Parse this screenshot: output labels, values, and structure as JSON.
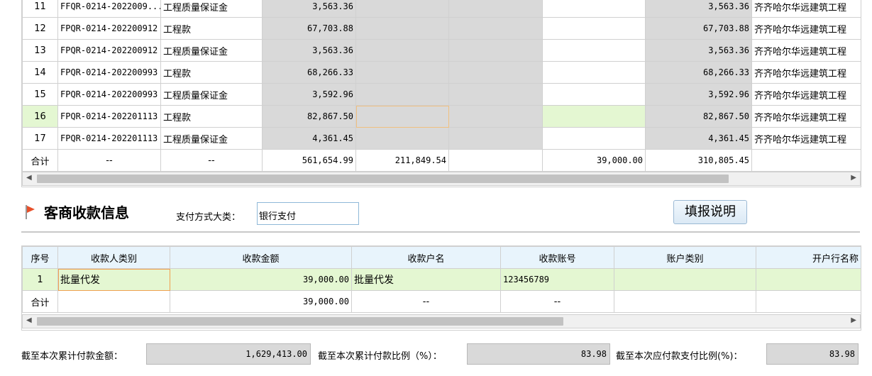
{
  "top_table": {
    "rows": [
      {
        "seq": "11",
        "code": "FFQR-0214-2022009...",
        "type": "工程质量保证金",
        "amount": "3,563.36",
        "c5": "",
        "c6": "",
        "c7": "",
        "c8": "3,563.36",
        "vendor": "齐齐哈尔华远建筑工程"
      },
      {
        "seq": "12",
        "code": "FPQR-0214-202200912",
        "type": "工程款",
        "amount": "67,703.88",
        "c5": "",
        "c6": "",
        "c7": "",
        "c8": "67,703.88",
        "vendor": "齐齐哈尔华远建筑工程"
      },
      {
        "seq": "13",
        "code": "FPQR-0214-202200912",
        "type": "工程质量保证金",
        "amount": "3,563.36",
        "c5": "",
        "c6": "",
        "c7": "",
        "c8": "3,563.36",
        "vendor": "齐齐哈尔华远建筑工程"
      },
      {
        "seq": "14",
        "code": "FPQR-0214-202200993",
        "type": "工程款",
        "amount": "68,266.33",
        "c5": "",
        "c6": "",
        "c7": "",
        "c8": "68,266.33",
        "vendor": "齐齐哈尔华远建筑工程"
      },
      {
        "seq": "15",
        "code": "FPQR-0214-202200993",
        "type": "工程质量保证金",
        "amount": "3,592.96",
        "c5": "",
        "c6": "",
        "c7": "",
        "c8": "3,592.96",
        "vendor": "齐齐哈尔华远建筑工程"
      },
      {
        "seq": "16",
        "code": "FPQR-0214-202201113",
        "type": "工程款",
        "amount": "82,867.50",
        "c5": "",
        "c6": "",
        "c7": "",
        "c8": "82,867.50",
        "vendor": "齐齐哈尔华远建筑工程"
      },
      {
        "seq": "17",
        "code": "FPQR-0214-202201113",
        "type": "工程质量保证金",
        "amount": "4,361.45",
        "c5": "",
        "c6": "",
        "c7": "",
        "c8": "4,361.45",
        "vendor": "齐齐哈尔华远建筑工程"
      }
    ],
    "total": {
      "label": "合计",
      "code": "--",
      "type": "--",
      "amount": "561,654.99",
      "c5": "211,849.54",
      "c6": "",
      "c7": "39,000.00",
      "c8": "310,805.45",
      "vendor": ""
    }
  },
  "section": {
    "title": "客商收款信息",
    "pay_method_label": "支付方式大类：",
    "pay_method_value": "银行支付",
    "help_button": "填报说明"
  },
  "recv_table": {
    "headers": [
      "序号",
      "收款人类别",
      "收款金额",
      "收款户名",
      "收款账号",
      "账户类别",
      "开户行名称"
    ],
    "rows": [
      {
        "seq": "1",
        "category": "批量代发",
        "amount": "39,000.00",
        "name": "批量代发",
        "account": "123456789",
        "acct_type": "",
        "bank": ""
      }
    ],
    "total": {
      "label": "合计",
      "category": "",
      "amount": "39,000.00",
      "name": "--",
      "account": "--",
      "acct_type": "",
      "bank": ""
    }
  },
  "footer": {
    "cum_amount_label": "截至本次累计付款金额：",
    "cum_amount_value": "1,629,413.00",
    "cum_ratio_label": "截至本次累计付款比例（%）：",
    "cum_ratio_value": "83.98",
    "due_ratio_label": "截至本次应付款支付比例(%)：",
    "due_ratio_value": "83.98"
  },
  "colors": {
    "accent_flag": "#e8502a",
    "row_highlight": "#e4f7d2",
    "readonly_gray": "#d9d9d9",
    "header_blue": "#e8f4fc"
  }
}
